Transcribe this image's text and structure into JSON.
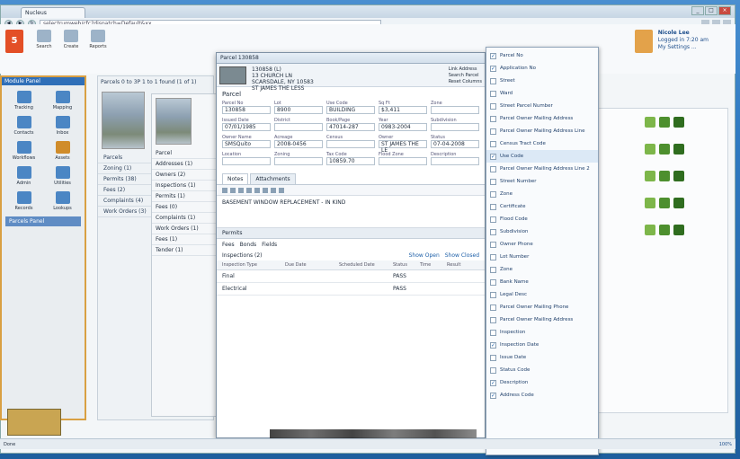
{
  "browser": {
    "tab_label": "Nucleus",
    "address": "selectrumweb/cfc?dispatch=Default&xx",
    "user_name": "Nicole Lee",
    "user_status": "Logged in 7:20 am",
    "user_link": "My Settings ..."
  },
  "toolbar": {
    "items": [
      "Search",
      "Create",
      "Reports"
    ]
  },
  "sidebar": {
    "heading": "Module Panel",
    "items": [
      {
        "label": "Tracking",
        "icon": "folder-icon"
      },
      {
        "label": "Mapping",
        "icon": "map-icon"
      },
      {
        "label": "Contacts",
        "icon": "contacts-icon"
      },
      {
        "label": "Inbox",
        "icon": "inbox-icon"
      },
      {
        "label": "Workflows",
        "icon": "workflow-icon"
      },
      {
        "label": "Assets",
        "icon": "assets-icon"
      },
      {
        "label": "Admin",
        "icon": "admin-icon"
      },
      {
        "label": "Utilities",
        "icon": "utilities-icon"
      },
      {
        "label": "Records",
        "icon": "records-icon"
      },
      {
        "label": "Lookups",
        "icon": "lookups-icon"
      }
    ],
    "selected": "Parcels Panel"
  },
  "center": {
    "title": "Parcels 0 to 3P 1 to 1 found (1 of 1)",
    "rows": [
      "Parcels",
      "Zoning (1)",
      "Permits (38)",
      "Fees (2)",
      "Complaints (4)",
      "Work Orders (3)"
    ]
  },
  "inner": {
    "rows": [
      "Parcel",
      "Addresses (1)",
      "Owners (2)",
      "Inspections (1)",
      "Permits (1)",
      "Fees (0)",
      "Complaints (1)",
      "Work Orders (1)",
      "Fees (1)",
      "Tender (1)"
    ]
  },
  "dialog": {
    "title": "Parcel 130858",
    "address_lines": [
      "130858 (L)",
      "13 CHURCH LN",
      "SCARSDALE, NY 10583",
      "ST JAMES THE LESS"
    ],
    "actions": [
      "Link Address",
      "Search Parcel",
      "Reset Columns"
    ],
    "section_label": "Parcel",
    "fields": [
      {
        "label": "Parcel No",
        "value": "130858"
      },
      {
        "label": "Lot",
        "value": "8900"
      },
      {
        "label": "Use Code",
        "value": "BUILDING"
      },
      {
        "label": "Sq Ft",
        "value": "$3,411"
      },
      {
        "label": "Zone",
        "value": ""
      },
      {
        "label": "Issued Date",
        "value": "07/01/1985"
      },
      {
        "label": "District",
        "value": ""
      },
      {
        "label": "Book/Page",
        "value": "47014-287"
      },
      {
        "label": "Year",
        "value": "0983-2004"
      },
      {
        "label": "Subdivision",
        "value": ""
      },
      {
        "label": "Owner Name",
        "value": "SMSQuito"
      },
      {
        "label": "Acreage",
        "value": "2008-0456"
      },
      {
        "label": "Census",
        "value": ""
      },
      {
        "label": "Owner",
        "value": "ST JAMES THE LE"
      },
      {
        "label": "Status",
        "value": "07-04-2008"
      },
      {
        "label": "Location",
        "value": ""
      },
      {
        "label": "Zoning",
        "value": ""
      },
      {
        "label": "Tax Code",
        "value": "10859.70"
      },
      {
        "label": "Flood Zone",
        "value": ""
      },
      {
        "label": "Description",
        "value": ""
      }
    ],
    "tabs": [
      "Notes",
      "Attachments"
    ],
    "notes_text": "BASEMENT WINDOW REPLACEMENT - IN KIND",
    "sub_head": "Permits",
    "sub_tabs": [
      "Fees",
      "Bonds",
      "Fields"
    ],
    "sub_title": "Inspections (2)",
    "table_links": [
      "Show Open",
      "Show Closed"
    ],
    "table_columns": [
      "Inspection Type",
      "Due Date",
      "Scheduled Date",
      "Status",
      "Time",
      "Result"
    ],
    "table_rows": [
      [
        "Final",
        "",
        "",
        "PASS",
        "",
        ""
      ],
      [
        "Electrical",
        "",
        "",
        "PASS",
        "",
        ""
      ]
    ]
  },
  "dropdown": {
    "items": [
      {
        "label": "Parcel No",
        "checked": true
      },
      {
        "label": "Application No",
        "checked": true
      },
      {
        "label": "Street",
        "checked": false
      },
      {
        "label": "Ward",
        "checked": false
      },
      {
        "label": "Street Parcel Number",
        "checked": false
      },
      {
        "label": "Parcel Owner Mailing Address",
        "checked": false
      },
      {
        "label": "Parcel Owner Mailing Address Line",
        "checked": false
      },
      {
        "label": "Census Tract Code",
        "checked": false
      },
      {
        "label": "Use Code",
        "checked": true
      },
      {
        "label": "Parcel Owner Mailing Address Line 2",
        "checked": false
      },
      {
        "label": "Street Number",
        "checked": false
      },
      {
        "label": "Zone",
        "checked": false
      },
      {
        "label": "Certificate",
        "checked": false
      },
      {
        "label": "Flood Code",
        "checked": false
      },
      {
        "label": "Subdivision",
        "checked": false
      },
      {
        "label": "Owner Phone",
        "checked": false
      },
      {
        "label": "Lot Number",
        "checked": false
      },
      {
        "label": "Zone",
        "checked": false
      },
      {
        "label": "Bank Name",
        "checked": false
      },
      {
        "label": "Legal Desc",
        "checked": false
      },
      {
        "label": "Parcel Owner Mailing Phone",
        "checked": false
      },
      {
        "label": "Parcel Owner Mailing Address",
        "checked": false
      },
      {
        "label": "Inspection",
        "checked": false
      },
      {
        "label": "Inspection Date",
        "checked": true
      },
      {
        "label": "Issue Date",
        "checked": false
      },
      {
        "label": "Status Code",
        "checked": false
      },
      {
        "label": "Description",
        "checked": true
      },
      {
        "label": "Address Code",
        "checked": true
      }
    ]
  },
  "status": {
    "left": "Done",
    "zoom": "100%"
  }
}
